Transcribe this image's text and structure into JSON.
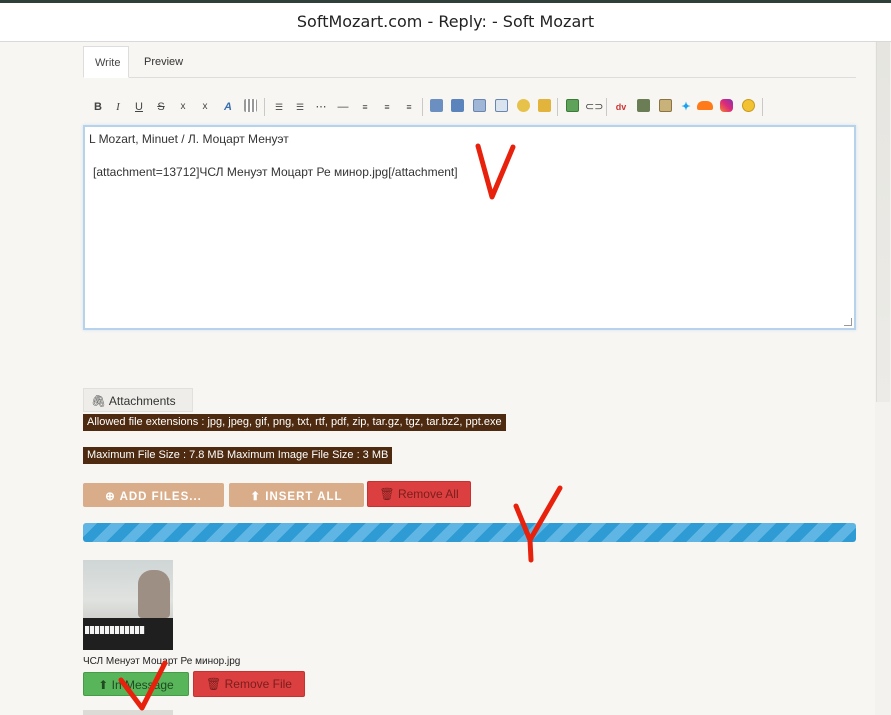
{
  "window": {
    "title": "SoftMozart.com - Reply: - Soft Mozart"
  },
  "editor_tabs": [
    {
      "label": "Write",
      "active": true
    },
    {
      "label": "Preview",
      "active": false
    }
  ],
  "toolbar": {
    "bold": "B",
    "italic": "I",
    "underline": "U",
    "strike": "S",
    "subscript": "x",
    "superscript": "x",
    "font": "A",
    "icons": [
      "bold-icon",
      "italic-icon",
      "underline-icon",
      "strikethrough-icon",
      "subscript-icon",
      "superscript-icon",
      "font-color-icon",
      "table-icon",
      "bullet-list-icon",
      "numbered-list-icon",
      "outdent-icon",
      "horizontal-rule-icon",
      "align-left-icon",
      "align-center-icon",
      "align-right-icon",
      "link-icon",
      "image-link-icon",
      "table-insert-icon",
      "code-icon",
      "badge-icon",
      "lock-icon",
      "image-icon",
      "unlink-icon",
      "video-icon",
      "film-icon",
      "picture-icon",
      "twitter-icon",
      "soundcloud-icon",
      "instagram-icon",
      "smiley-icon"
    ]
  },
  "editor": {
    "line1": "L Mozart, Minuet / Л. Моцарт Менуэт",
    "line2": "[attachment=13712]ЧСЛ Менуэт Моцарт Ре минор.jpg[/attachment]"
  },
  "attachments": {
    "label": "Attachments",
    "allowed_extensions": "Allowed file extensions : jpg, jpeg, gif, png, txt, rtf, pdf, zip, tar.gz, tgz, tar.bz2, ppt.exe",
    "max_size": "Maximum File Size : 7.8 MB Maximum Image File Size : 3 MB",
    "add_files": "ADD FILES...",
    "insert_all": "INSERT ALL",
    "remove_all": "Remove All",
    "upload_progress": 1.0,
    "file_name": "ЧСЛ Менуэт Моцарт Ре минор.jpg",
    "in_message": "In Message",
    "remove_file": "Remove File"
  },
  "colors": {
    "note_bg": "#4e2b10",
    "tan_button": "#d9ad8a",
    "red_button": "#dc3f3f",
    "green_button": "#58b55a",
    "progress": "#2f9bd5",
    "annotation": "#e8210d"
  }
}
